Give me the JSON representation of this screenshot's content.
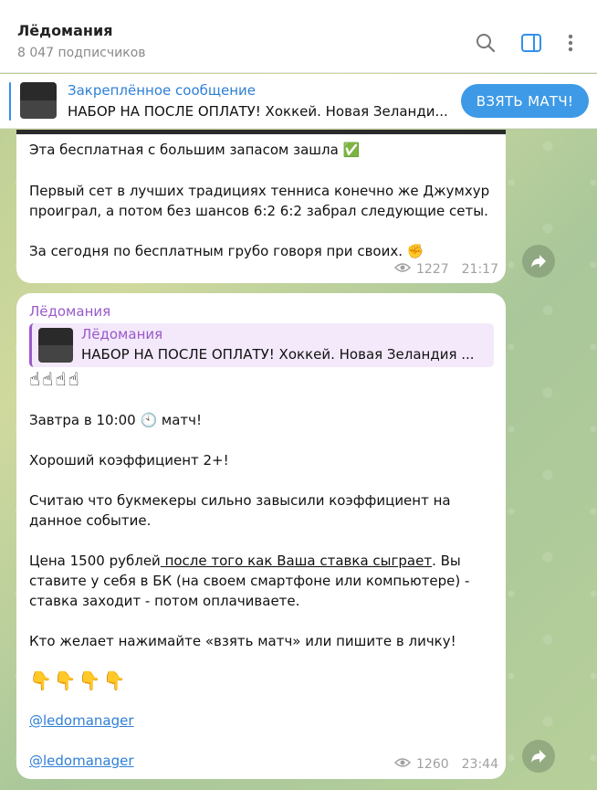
{
  "header": {
    "title": "Лёдомания",
    "subtitle": "8 047 подписчиков",
    "icons": [
      "search-icon",
      "sidebar-icon",
      "more-icon"
    ]
  },
  "pinned": {
    "title": "Закреплённое сообщение",
    "text": "НАБОР НА ПОСЛЕ ОПЛАТУ!   Хоккей. Новая Зеланди...",
    "button_label": "ВЗЯТЬ МАТЧ!"
  },
  "message1": {
    "line1": "Эта бесплатная с большим запасом зашла ✅",
    "line2": "Первый сет в лучших традициях тенниса конечно же Джумхур",
    "line3": "проиграл, а потом без шансов 6:2 6:2 забрал следующие сеты.",
    "line4": "За сегодня по бесплатным грубо говоря при своих. ✊",
    "views": "1227",
    "time": "21:17"
  },
  "message2": {
    "author": "Лёдомания",
    "reply_title": "Лёдомания",
    "reply_text": "НАБОР НА ПОСЛЕ ОПЛАТУ!   Хоккей. Новая Зеландия ...",
    "emoji_up": "☝☝☝☝",
    "line1": "Завтра в 10:00 🕙 матч!",
    "line2": "Хороший коэффициент 2+!",
    "line3": "Считаю что букмекеры сильно завысили коэффициент на",
    "line4": "данное событие.",
    "line5_a": "Цена 1500 рублей",
    "line5_link": " после того как Ваша ставка сыграет",
    "line5_b": ". Вы",
    "line6": "ставите у себя в БК (на своем смартфоне или компьютере) -",
    "line7": "ставка заходит - потом оплачиваете.",
    "line8": "Кто желает нажимайте «взять матч» или пишите в личку!",
    "emoji_down": "👇👇👇👇",
    "link1": "@ledomanager",
    "link2": "@ledomanager",
    "views": "1260",
    "time": "23:44"
  }
}
